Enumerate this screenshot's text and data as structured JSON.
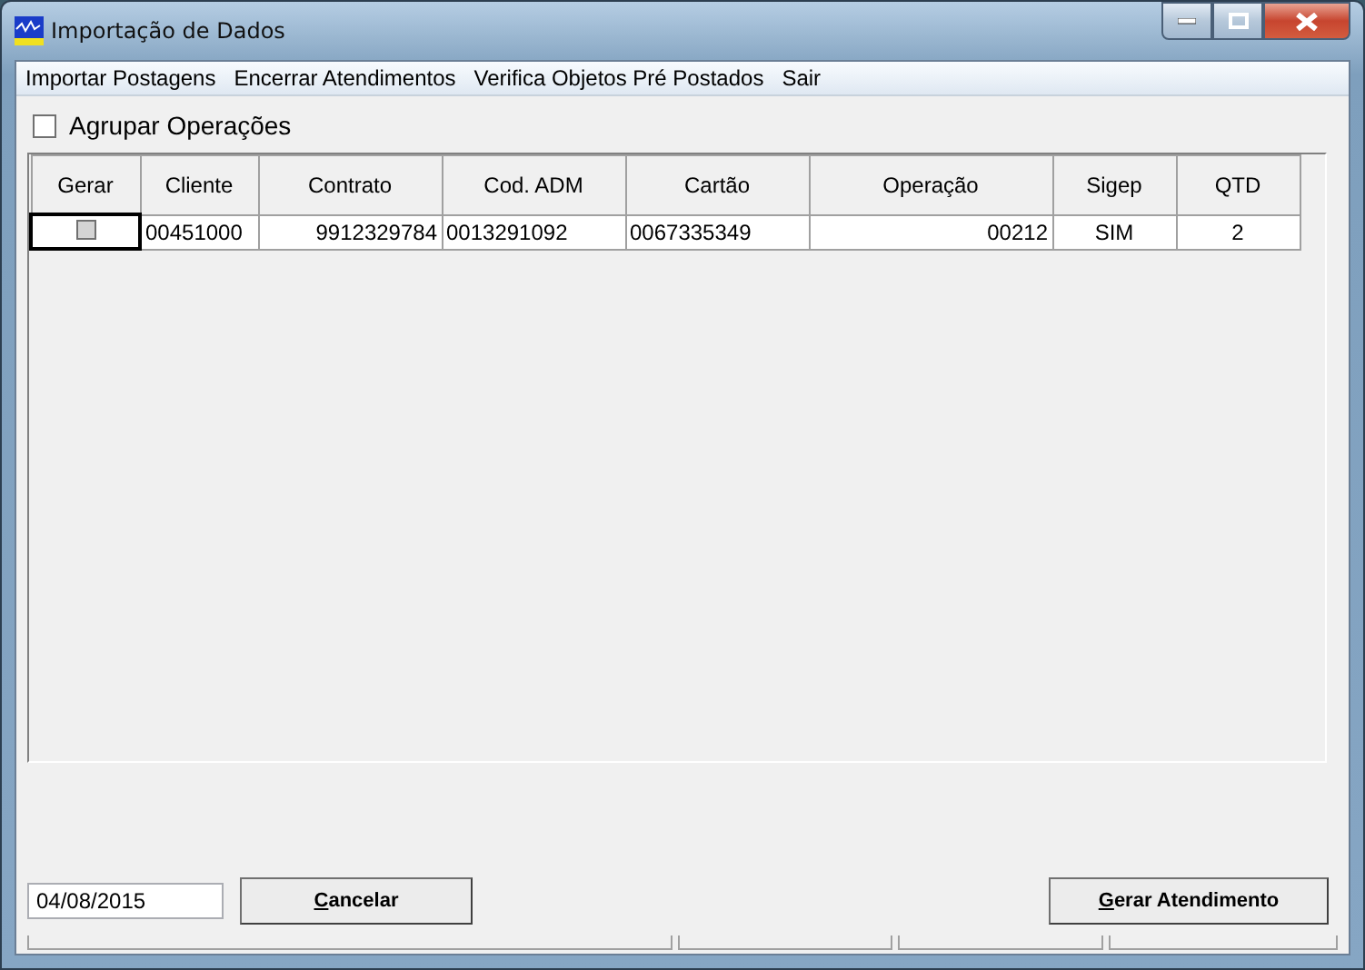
{
  "window": {
    "title": "Importação de Dados"
  },
  "menu": [
    "Importar Postagens",
    "Encerrar Atendimentos",
    "Verifica Objetos Pré Postados",
    "Sair"
  ],
  "group_option": {
    "label": "Agrupar Operações",
    "checked": false
  },
  "table": {
    "columns": [
      "Gerar",
      "Cliente",
      "Contrato",
      "Cod. ADM",
      "Cartão",
      "Operação",
      "Sigep",
      "QTD"
    ],
    "rows": [
      {
        "gerar": false,
        "cells": [
          "",
          "00451000",
          "9912329784",
          "0013291092",
          "0067335349",
          "00212",
          "SIM",
          "2"
        ]
      }
    ]
  },
  "date_field": {
    "value": "04/08/2015"
  },
  "buttons": [
    {
      "label": "Cancelar"
    },
    {
      "label": "Gerar Atendimento"
    }
  ]
}
